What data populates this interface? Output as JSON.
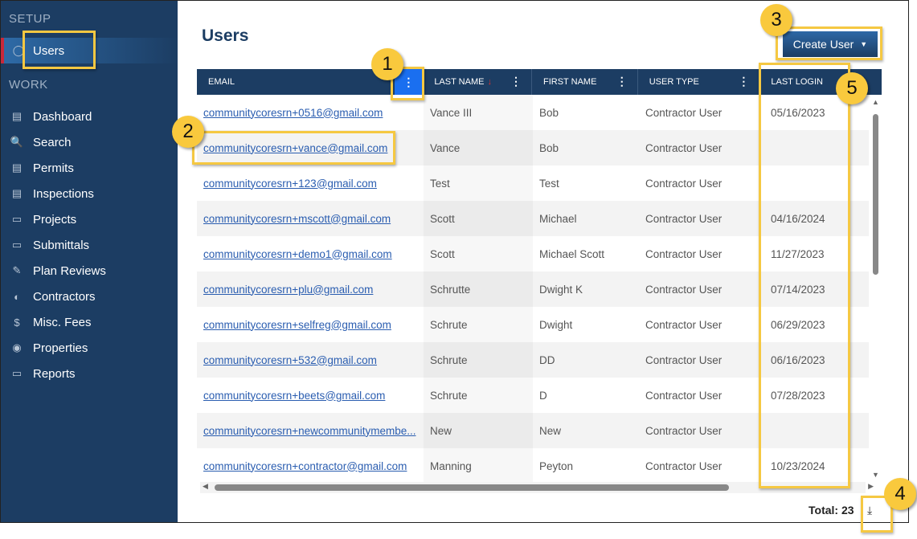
{
  "sidebar": {
    "setup_label": "SETUP",
    "work_label": "WORK",
    "setup_items": [
      {
        "label": "Users",
        "icon": "user-icon",
        "active": true
      }
    ],
    "work_items": [
      {
        "label": "Dashboard",
        "icon": "chart-icon"
      },
      {
        "label": "Search",
        "icon": "search-icon"
      },
      {
        "label": "Permits",
        "icon": "document-icon"
      },
      {
        "label": "Inspections",
        "icon": "clipboard-icon"
      },
      {
        "label": "Projects",
        "icon": "folder-icon"
      },
      {
        "label": "Submittals",
        "icon": "folder-icon"
      },
      {
        "label": "Plan Reviews",
        "icon": "document-edit-icon"
      },
      {
        "label": "Contractors",
        "icon": "hardhat-icon"
      },
      {
        "label": "Misc. Fees",
        "icon": "money-icon"
      },
      {
        "label": "Properties",
        "icon": "location-pin-icon"
      },
      {
        "label": "Reports",
        "icon": "folder-open-icon"
      }
    ]
  },
  "header": {
    "title": "Users",
    "create_button": "Create User"
  },
  "table": {
    "columns": [
      "EMAIL",
      "LAST NAME",
      "FIRST NAME",
      "USER TYPE",
      "LAST LOGIN"
    ],
    "sort": {
      "column": "LAST NAME",
      "direction": "descending"
    },
    "rows": [
      [
        "communitycoresrn+0516@gmail.com",
        "Vance III",
        "Bob",
        "Contractor User",
        "05/16/2023"
      ],
      [
        "communitycoresrn+vance@gmail.com",
        "Vance",
        "Bob",
        "Contractor User",
        ""
      ],
      [
        "communitycoresrn+123@gmail.com",
        "Test",
        "Test",
        "Contractor User",
        ""
      ],
      [
        "communitycoresrn+mscott@gmail.com",
        "Scott",
        "Michael",
        "Contractor User",
        "04/16/2024"
      ],
      [
        "communitycoresrn+demo1@gmail.com",
        "Scott",
        "Michael Scott",
        "Contractor User",
        "11/27/2023"
      ],
      [
        "communitycoresrn+plu@gmail.com",
        "Schrutte",
        "Dwight K",
        "Contractor User",
        "07/14/2023"
      ],
      [
        "communitycoresrn+selfreg@gmail.com",
        "Schrute",
        "Dwight",
        "Contractor User",
        "06/29/2023"
      ],
      [
        "communitycoresrn+532@gmail.com",
        "Schrute",
        "DD",
        "Contractor User",
        "06/16/2023"
      ],
      [
        "communitycoresrn+beets@gmail.com",
        "Schrute",
        "D",
        "Contractor User",
        "07/28/2023"
      ],
      [
        "communitycoresrn+newcommunitymembe...",
        "New",
        "New",
        "Contractor User",
        ""
      ],
      [
        "communitycoresrn+contractor@gmail.com",
        "Manning",
        "Peyton",
        "Contractor User",
        "10/23/2024"
      ]
    ]
  },
  "footer": {
    "total": "Total: 23"
  },
  "callouts": [
    "1",
    "2",
    "3",
    "4",
    "5"
  ],
  "colors": {
    "sidebar": "#1c3d63",
    "accent": "#1a6ff0",
    "callout": "#f9c93d",
    "link": "#2a5db0"
  }
}
